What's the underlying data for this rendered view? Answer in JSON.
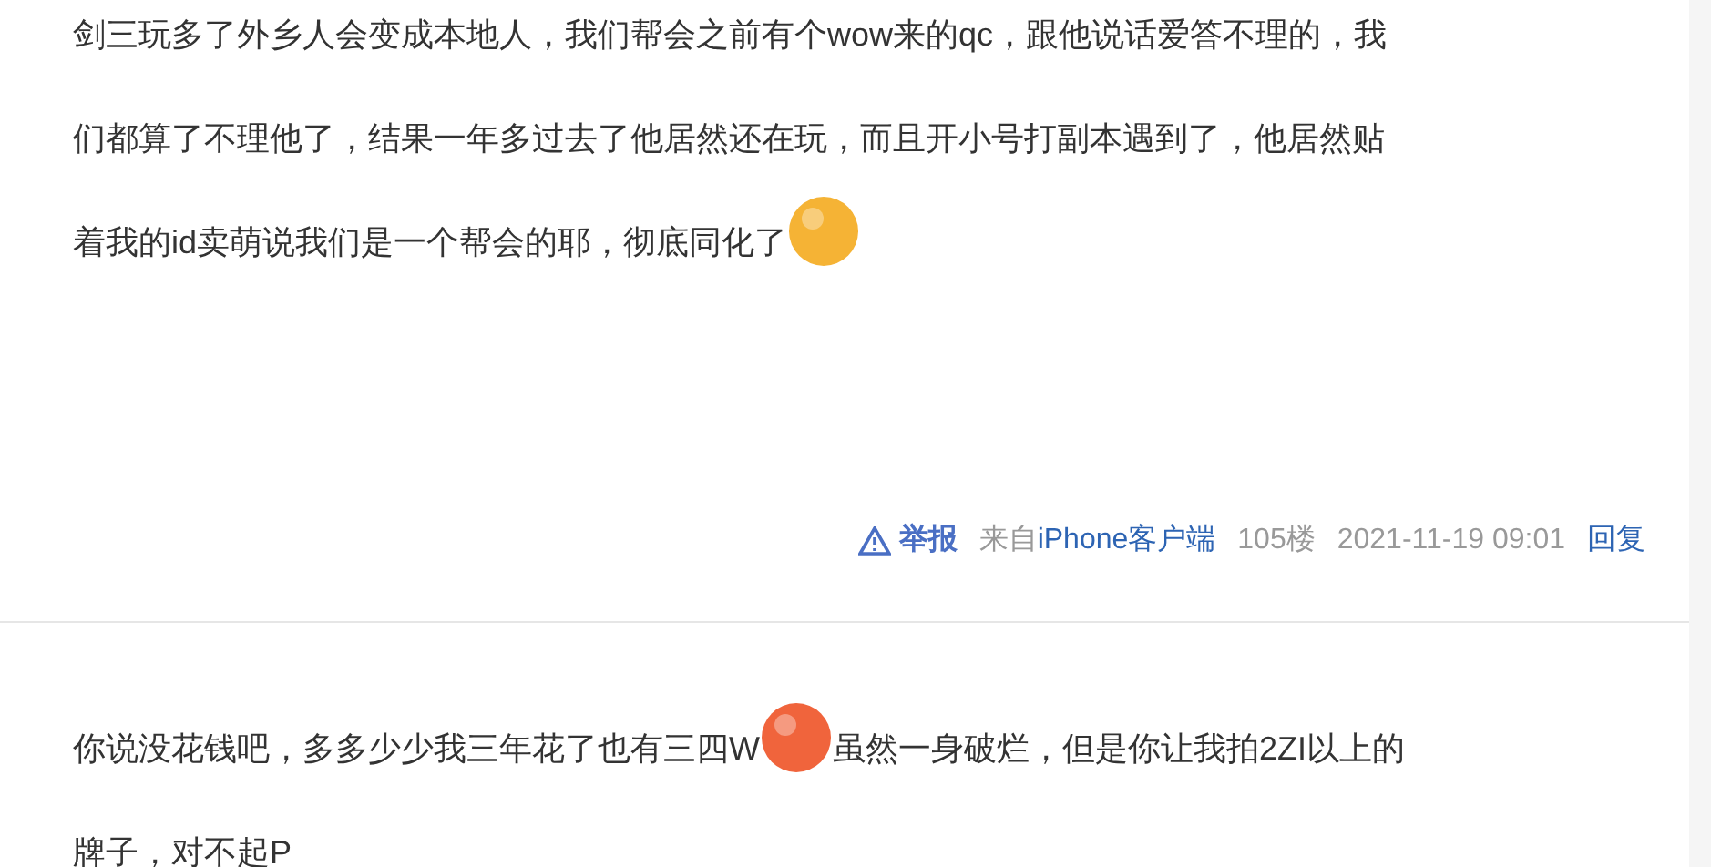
{
  "posts": [
    {
      "lines": [
        [
          {
            "kind": "text",
            "text": "剑三玩多了外乡人会变成本地人，我们帮会之前有个wow来的qc，跟他说话爱答不理的，我"
          }
        ],
        [
          {
            "kind": "text",
            "text": "们都算了不理他了，结果一年多过去了他居然还在玩，而且开小号打副本遇到了，他居然贴"
          }
        ],
        [
          {
            "kind": "text",
            "text": "着我的id卖萌说我们是一个帮会的耶，彻底同化了"
          },
          {
            "kind": "emoji",
            "color": "#f5b335"
          }
        ]
      ],
      "footer": {
        "report": "举报",
        "source_prefix": "来自",
        "source": "iPhone客户端",
        "floor": "105楼",
        "time": "2021-11-19 09:01",
        "reply": "回复"
      }
    },
    {
      "lines": [
        [
          {
            "kind": "text",
            "text": "你说没花钱吧，多多少少我三年花了也有三四W"
          },
          {
            "kind": "emoji",
            "color": "#f0643c"
          },
          {
            "kind": "text",
            "text": "虽然一身破烂，但是你让我拍2ZI以上的"
          }
        ],
        [
          {
            "kind": "text",
            "text": "牌子，对不起P"
          }
        ]
      ]
    }
  ]
}
